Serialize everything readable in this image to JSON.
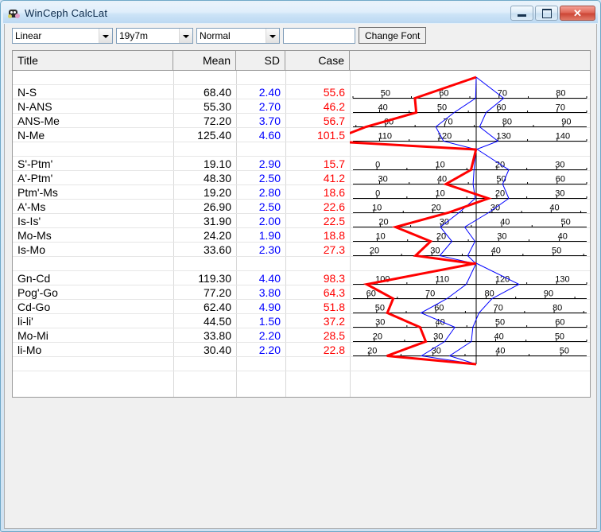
{
  "window": {
    "title": "WinCeph CalcLat",
    "icon": "app-icon",
    "buttons": {
      "minimize": "–",
      "maximize": "□",
      "close": "✕"
    }
  },
  "toolbar": {
    "type_select": {
      "value": "Linear",
      "options": [
        "Linear"
      ]
    },
    "age_select": {
      "value": "19y7m",
      "options": [
        "19y7m"
      ]
    },
    "norm_select": {
      "value": "Normal",
      "options": [
        "Normal"
      ]
    },
    "blank_field": {
      "value": "",
      "placeholder": ""
    },
    "change_font_label": "Change Font"
  },
  "grid": {
    "headers": {
      "title": "Title",
      "mean": "Mean",
      "sd": "SD",
      "case": "Case",
      "chart": ""
    },
    "colors": {
      "mean": "#000000",
      "sd": "#0000ff",
      "case": "#ff0000"
    },
    "rows": [
      {
        "title": "",
        "mean": "",
        "sd": "",
        "case": "",
        "spacer": true
      },
      {
        "title": "N-S",
        "mean": "68.40",
        "sd": "2.40",
        "case": "55.6"
      },
      {
        "title": "N-ANS",
        "mean": "55.30",
        "sd": "2.70",
        "case": "46.2"
      },
      {
        "title": "ANS-Me",
        "mean": "72.20",
        "sd": "3.70",
        "case": "56.7"
      },
      {
        "title": "N-Me",
        "mean": "125.40",
        "sd": "4.60",
        "case": "101.5"
      },
      {
        "title": "",
        "mean": "",
        "sd": "",
        "case": "",
        "spacer": true
      },
      {
        "title": "S'-Ptm'",
        "mean": "19.10",
        "sd": "2.90",
        "case": "15.7"
      },
      {
        "title": "A'-Ptm'",
        "mean": "48.30",
        "sd": "2.50",
        "case": "41.2"
      },
      {
        "title": "Ptm'-Ms",
        "mean": "19.20",
        "sd": "2.80",
        "case": "18.6"
      },
      {
        "title": "A'-Ms",
        "mean": "26.90",
        "sd": "2.50",
        "case": "22.6"
      },
      {
        "title": "Is-Is'",
        "mean": "31.90",
        "sd": "2.00",
        "case": "22.5"
      },
      {
        "title": "Mo-Ms",
        "mean": "24.20",
        "sd": "1.90",
        "case": "18.8"
      },
      {
        "title": "Is-Mo",
        "mean": "33.60",
        "sd": "2.30",
        "case": "27.3"
      },
      {
        "title": "",
        "mean": "",
        "sd": "",
        "case": "",
        "spacer": true
      },
      {
        "title": "Gn-Cd",
        "mean": "119.30",
        "sd": "4.40",
        "case": "98.3"
      },
      {
        "title": "Pog'-Go",
        "mean": "77.20",
        "sd": "3.80",
        "case": "64.3"
      },
      {
        "title": "Cd-Go",
        "mean": "62.40",
        "sd": "4.90",
        "case": "51.8"
      },
      {
        "title": "li-li'",
        "mean": "44.50",
        "sd": "1.50",
        "case": "37.2"
      },
      {
        "title": "Mo-Mi",
        "mean": "33.80",
        "sd": "2.20",
        "case": "28.5"
      },
      {
        "title": "li-Mo",
        "mean": "30.40",
        "sd": "2.20",
        "case": "22.8"
      },
      {
        "title": "",
        "mean": "",
        "sd": "",
        "case": "",
        "spacer": true
      }
    ]
  },
  "chart_data": {
    "type": "line",
    "title": "",
    "description": "Cephalometric polygon chart: red line = Case values, blue lines = +/-1 SD envelope around the mean, vertical black line = mean (centre of each scale).",
    "xlabel": "",
    "ylabel": "",
    "grid": true,
    "legend": {
      "case_color": "#ff0000",
      "sd_color": "#0000ff",
      "axis_color": "#000000"
    },
    "center_axis_value_label": "mean",
    "measurements": [
      {
        "name": "N-S",
        "mean": 68.4,
        "sd": 2.4,
        "case": 55.6,
        "scale_ticks": [
          50,
          60,
          70,
          80
        ],
        "scale_min": 45.0,
        "scale_max": 85.0
      },
      {
        "name": "N-ANS",
        "mean": 55.3,
        "sd": 2.7,
        "case": 46.2,
        "scale_ticks": [
          40,
          50,
          60,
          70
        ],
        "scale_min": 35.5,
        "scale_max": 75.0
      },
      {
        "name": "ANS-Me",
        "mean": 72.2,
        "sd": 3.7,
        "case": 56.7,
        "scale_ticks": [
          60,
          70,
          80,
          90
        ],
        "scale_min": 54.5,
        "scale_max": 94.0
      },
      {
        "name": "N-Me",
        "mean": 125.4,
        "sd": 4.6,
        "case": 101.5,
        "scale_ticks": [
          110,
          120,
          130,
          140
        ],
        "scale_min": 105.5,
        "scale_max": 145.0
      },
      {
        "name": "S'-Ptm'",
        "mean": 19.1,
        "sd": 2.9,
        "case": 15.7,
        "scale_ticks": [
          0,
          10,
          20,
          30
        ],
        "scale_min": -4.0,
        "scale_max": 35.0
      },
      {
        "name": "A'-Ptm'",
        "mean": 48.3,
        "sd": 2.5,
        "case": 41.2,
        "scale_ticks": [
          30,
          40,
          50,
          60
        ],
        "scale_min": 25.5,
        "scale_max": 65.0
      },
      {
        "name": "Ptm'-Ms",
        "mean": 19.2,
        "sd": 2.8,
        "case": 18.6,
        "scale_ticks": [
          0,
          10,
          20,
          30
        ],
        "scale_min": -4.0,
        "scale_max": 35.0
      },
      {
        "name": "A'-Ms",
        "mean": 26.9,
        "sd": 2.5,
        "case": 22.6,
        "scale_ticks": [
          10,
          20,
          30,
          40
        ],
        "scale_min": 6.5,
        "scale_max": 46.0
      },
      {
        "name": "Is-Is'",
        "mean": 31.9,
        "sd": 2.0,
        "case": 22.5,
        "scale_ticks": [
          20,
          30,
          40,
          50
        ],
        "scale_min": 15.5,
        "scale_max": 54.0
      },
      {
        "name": "Mo-Ms",
        "mean": 24.2,
        "sd": 1.9,
        "case": 18.8,
        "scale_ticks": [
          10,
          20,
          30,
          40
        ],
        "scale_min": 6.0,
        "scale_max": 44.5
      },
      {
        "name": "Is-Mo",
        "mean": 33.6,
        "sd": 2.3,
        "case": 27.3,
        "scale_ticks": [
          20,
          30,
          40,
          50
        ],
        "scale_min": 17.0,
        "scale_max": 55.5
      },
      {
        "name": "Gn-Cd",
        "mean": 119.3,
        "sd": 4.4,
        "case": 98.3,
        "scale_ticks": [
          100,
          110,
          120,
          130
        ],
        "scale_min": 96.0,
        "scale_max": 135.0
      },
      {
        "name": "Pog'-Go",
        "mean": 77.2,
        "sd": 3.8,
        "case": 64.3,
        "scale_ticks": [
          60,
          70,
          80,
          90
        ],
        "scale_min": 57.5,
        "scale_max": 97.0
      },
      {
        "name": "Cd-Go",
        "mean": 62.4,
        "sd": 4.9,
        "case": 51.8,
        "scale_ticks": [
          50,
          60,
          70,
          80
        ],
        "scale_min": 46.0,
        "scale_max": 85.5
      },
      {
        "name": "li-li'",
        "mean": 44.5,
        "sd": 1.5,
        "case": 37.2,
        "scale_ticks": [
          30,
          40,
          50,
          60
        ],
        "scale_min": 26.0,
        "scale_max": 65.0
      },
      {
        "name": "Mo-Mi",
        "mean": 33.8,
        "sd": 2.2,
        "case": 28.5,
        "scale_ticks": [
          20,
          30,
          40,
          50
        ],
        "scale_min": 16.5,
        "scale_max": 55.0
      },
      {
        "name": "li-Mo",
        "mean": 30.4,
        "sd": 2.2,
        "case": 22.8,
        "scale_ticks": [
          20,
          30,
          40,
          50
        ],
        "scale_min": 17.5,
        "scale_max": 54.0
      }
    ]
  }
}
